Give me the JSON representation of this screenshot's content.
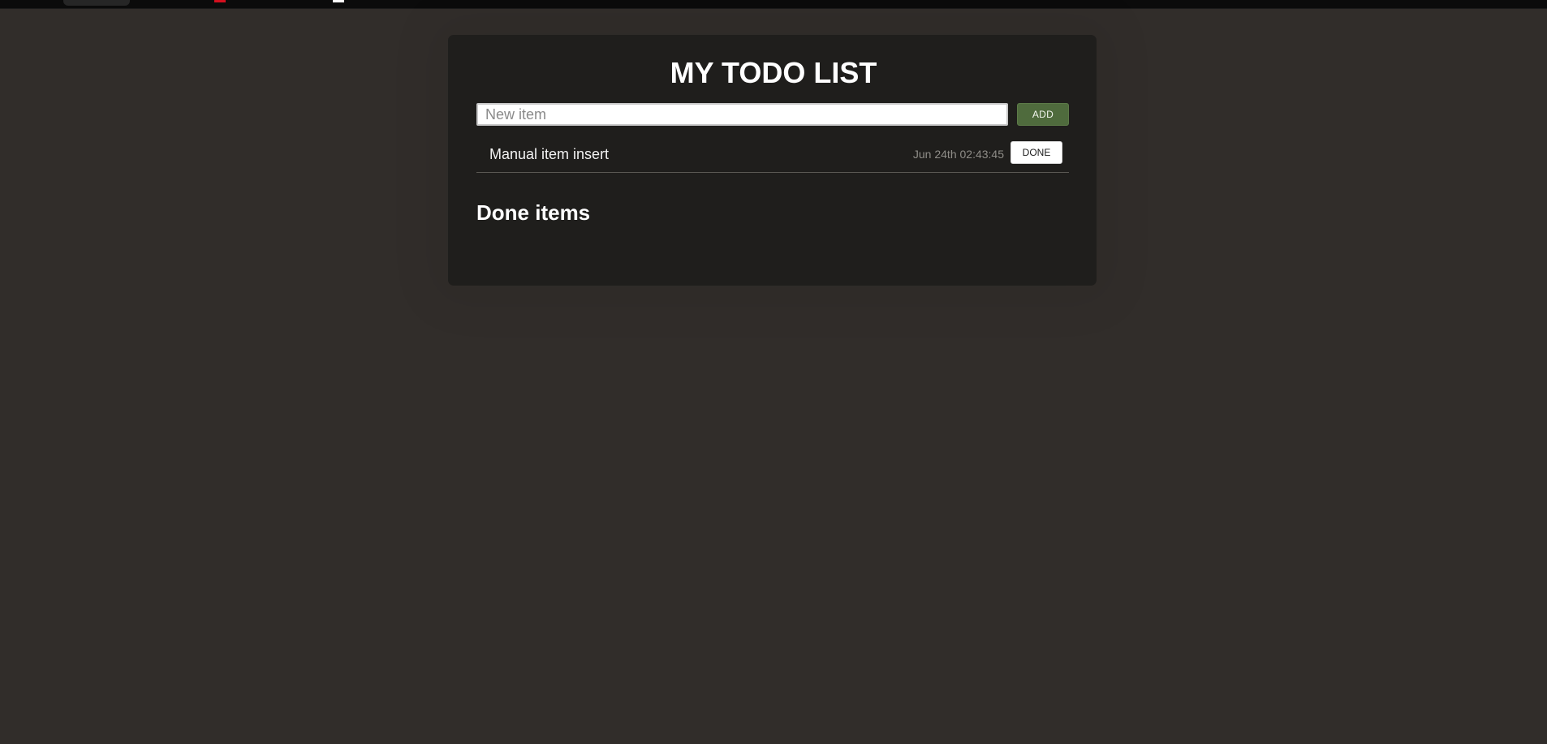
{
  "app": {
    "title": "MY TODO LIST"
  },
  "new_item": {
    "value": "",
    "placeholder": "New item",
    "add_label": "ADD"
  },
  "todo_items": [
    {
      "text": "Manual item insert",
      "timestamp": "Jun 24th 02:43:45",
      "done_label": "DONE"
    }
  ],
  "done_section": {
    "heading": "Done items",
    "items": []
  },
  "colors": {
    "background": "#312d2a",
    "card": "#1f1e1c",
    "add_button": "#4f6b3d",
    "done_button": "#ffffff",
    "divider": "#5b5954"
  }
}
